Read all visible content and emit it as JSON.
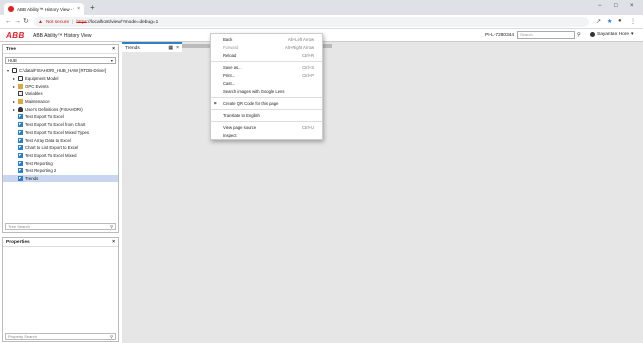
{
  "browser": {
    "tab_title": "ABB Ability™ History View - Tren",
    "tab_close": "×",
    "new_tab": "+",
    "address": {
      "warning": "Not secure",
      "protocol": "https",
      "url_rest": "://localhost/view/?mode=debug=1"
    },
    "window_controls": [
      "−",
      "□",
      "×"
    ]
  },
  "app": {
    "logo": "ABB",
    "title": "ABB Ability™ History View",
    "host": "PI-L-7280344",
    "search_placeholder": "Search",
    "user": "Sayantan Hore"
  },
  "tree_panel": {
    "title": "Tree",
    "close": "×",
    "selector_value": "HUB",
    "filter_placeholder": "Tree Search",
    "nodes": [
      {
        "label": "C:\\data\\FISAHORI_HUB_HAW [RTDB-Driver]",
        "icon": "server-icon",
        "depth": 0,
        "toggle": "▾"
      },
      {
        "label": "Equipment Model",
        "icon": "server-icon",
        "depth": 1,
        "toggle": "▸"
      },
      {
        "label": "OPC Events",
        "icon": "folder-icon",
        "depth": 1,
        "toggle": "▸"
      },
      {
        "label": "Variables",
        "icon": "table-icon",
        "depth": 1,
        "toggle": ""
      },
      {
        "label": "Maintenance",
        "icon": "folder-icon",
        "depth": 1,
        "toggle": "▸"
      },
      {
        "label": "User's Definitions (FISAHORI)",
        "icon": "user-icon",
        "depth": 1,
        "toggle": "▸"
      },
      {
        "label": "Test Export To Excel",
        "icon": "chart-icon",
        "depth": 1,
        "toggle": ""
      },
      {
        "label": "Test Export To Excel from Chart",
        "icon": "chart-icon",
        "depth": 1,
        "toggle": ""
      },
      {
        "label": "Test Export To Excel Mixed Types",
        "icon": "chart-icon",
        "depth": 1,
        "toggle": ""
      },
      {
        "label": "Test Array Data to Excel",
        "icon": "chart-icon",
        "depth": 1,
        "toggle": ""
      },
      {
        "label": "Chart to List Export to Excel",
        "icon": "chart-icon",
        "depth": 1,
        "toggle": ""
      },
      {
        "label": "Test Export To Excel Mixed",
        "icon": "chart-icon",
        "depth": 1,
        "toggle": ""
      },
      {
        "label": "Test Reporting",
        "icon": "chart-icon",
        "depth": 1,
        "toggle": ""
      },
      {
        "label": "Test Reporting 2",
        "icon": "chart-icon",
        "depth": 1,
        "toggle": ""
      },
      {
        "label": "Trends",
        "icon": "chart-icon",
        "depth": 1,
        "toggle": "",
        "selected": true
      }
    ]
  },
  "properties_panel": {
    "title": "Properties",
    "close": "×",
    "search_placeholder": "Property Search"
  },
  "trends": {
    "tab_label": "Trends"
  },
  "context_menu": {
    "items": [
      {
        "label": "Back",
        "shortcut": "Alt+Left Arrow"
      },
      {
        "label": "Forward",
        "shortcut": "Alt+Right Arrow",
        "disabled": true
      },
      {
        "label": "Reload",
        "shortcut": "Ctrl+R"
      },
      {
        "sep": true
      },
      {
        "label": "Save as...",
        "shortcut": "Ctrl+S"
      },
      {
        "label": "Print...",
        "shortcut": "Ctrl+P"
      },
      {
        "label": "Cast...",
        "shortcut": ""
      },
      {
        "label": "Search images with Google Lens",
        "shortcut": ""
      },
      {
        "sep": true
      },
      {
        "label": "Create QR Code for this page",
        "shortcut": "",
        "icon": "⌗"
      },
      {
        "sep": true
      },
      {
        "label": "Translate to English",
        "shortcut": ""
      },
      {
        "sep": true
      },
      {
        "label": "View page source",
        "shortcut": "Ctrl+U"
      },
      {
        "label": "Inspect",
        "shortcut": ""
      }
    ]
  }
}
